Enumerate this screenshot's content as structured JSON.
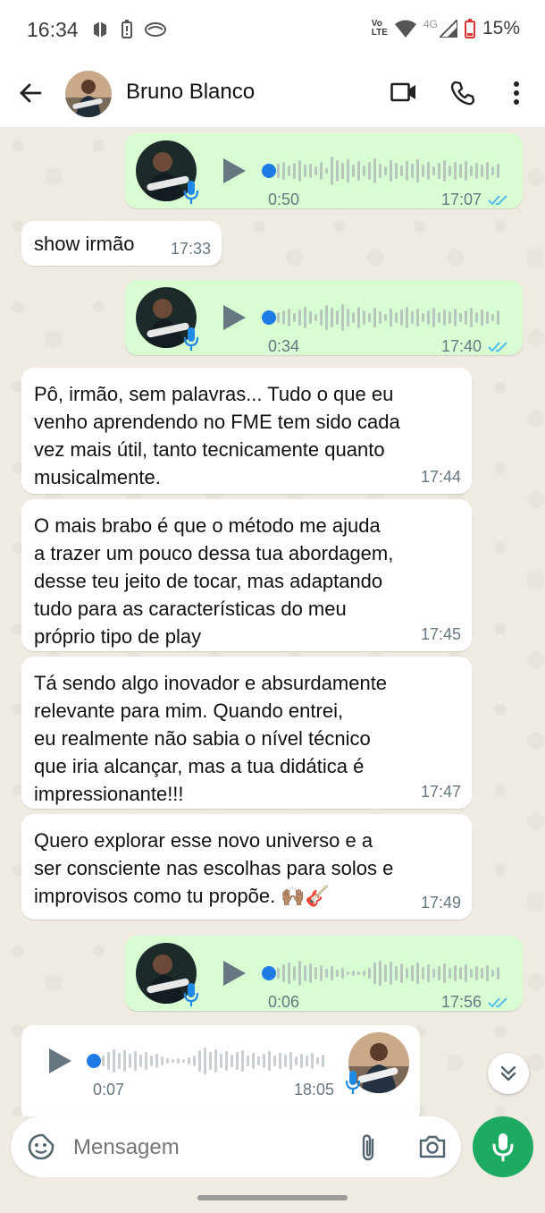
{
  "status_bar": {
    "time": "16:34",
    "volte": "Vo\nLTE",
    "network": "4G",
    "battery": "15%"
  },
  "header": {
    "contact_name": "Bruno Blanco",
    "icons": [
      "back-arrow-icon",
      "avatar",
      "video-call-icon",
      "voice-call-icon",
      "more-options-icon"
    ]
  },
  "messages": [
    {
      "type": "audio",
      "direction": "out",
      "duration": "0:50",
      "time": "17:07",
      "read": true
    },
    {
      "type": "text",
      "direction": "in",
      "text": "show irmão",
      "time": "17:33"
    },
    {
      "type": "audio",
      "direction": "out",
      "duration": "0:34",
      "time": "17:40",
      "read": true
    },
    {
      "type": "text",
      "direction": "in",
      "text": "Pô, irmão, sem palavras... Tudo o que eu\nvenho aprendendo no FME tem sido cada\nvez mais útil, tanto tecnicamente quanto\nmusicalmente.",
      "time": "17:44"
    },
    {
      "type": "text",
      "direction": "in",
      "text": "O mais brabo é que o método me ajuda\na trazer um pouco dessa tua abordagem,\ndesse teu jeito de tocar, mas adaptando\ntudo para as características do meu\npróprio tipo de play",
      "time": "17:45"
    },
    {
      "type": "text",
      "direction": "in",
      "text": "Tá sendo algo inovador e absurdamente\nrelevante para mim. Quando entrei,\neu realmente não sabia o nível técnico\nque iria alcançar, mas a tua didática é\nimpressionante!!!",
      "time": "17:47"
    },
    {
      "type": "text",
      "direction": "in",
      "text": "Quero explorar esse novo universo e a\nser consciente nas escolhas para solos e\nimprovisos como tu propõe. 🙌🏽🎸",
      "time": "17:49"
    },
    {
      "type": "audio",
      "direction": "out",
      "duration": "0:06",
      "time": "17:56",
      "read": true
    },
    {
      "type": "audio",
      "direction": "in",
      "duration": "0:07",
      "time": "18:05"
    }
  ],
  "composer": {
    "placeholder": "Mensagem"
  },
  "colors": {
    "outgoing": "#d9fdd3",
    "incoming": "#ffffff",
    "accent": "#1daa61",
    "read_ticks": "#53bdeb",
    "progress_dot": "#1e7be6"
  }
}
